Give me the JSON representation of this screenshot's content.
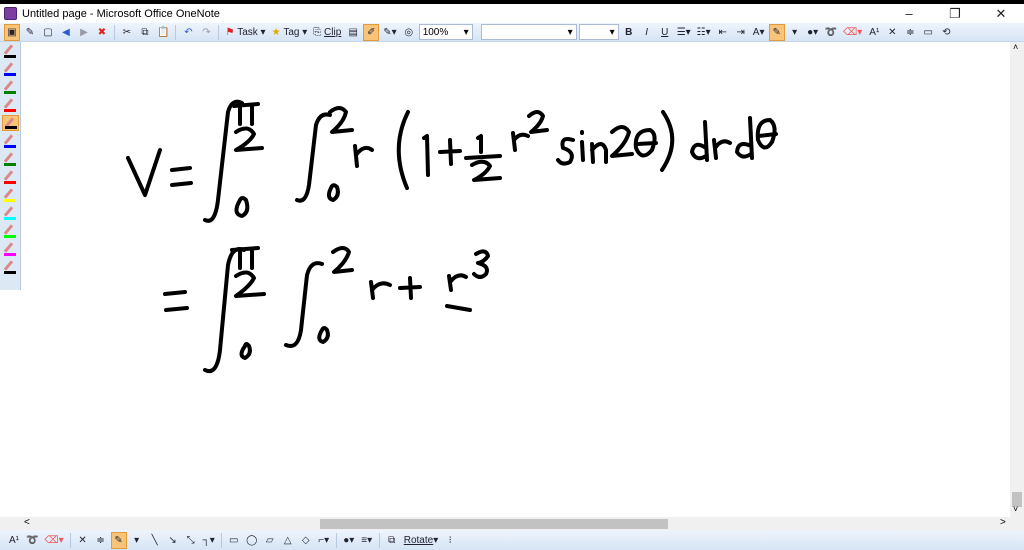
{
  "window": {
    "title": "Untitled page - Microsoft Office OneNote",
    "minimize": "–",
    "restore": "❐",
    "close": "✕"
  },
  "toolbar": {
    "task": "Task",
    "tag": "Tag",
    "clip": "Clip",
    "zoom": "100%",
    "font": "",
    "size": "",
    "bold": "B",
    "italic": "I",
    "underline": "U",
    "superscript": "A¹"
  },
  "pens": {
    "colors": [
      "#000000",
      "#0000ff",
      "#008000",
      "#ff0000",
      "#000000",
      "#0000ff",
      "#008000",
      "#ff0000",
      "#ffff00",
      "#00ffff",
      "#00ff00",
      "#ff00ff",
      "#000000"
    ],
    "selected_index": 4
  },
  "bottombar": {
    "rotate": "Rotate",
    "superscript": "A¹"
  },
  "scroll": {
    "left_arrow": "<",
    "right_arrow": ">",
    "up_arrow": "˄",
    "down_arrow": "˅"
  },
  "ink": {
    "line1": "V = ∫_0^{π/2} ∫_0^2 r (1 + ½ r² sin2θ) dr dθ",
    "line2": "= ∫_0^{π/2} ∫_0^2 r + r³/–"
  }
}
